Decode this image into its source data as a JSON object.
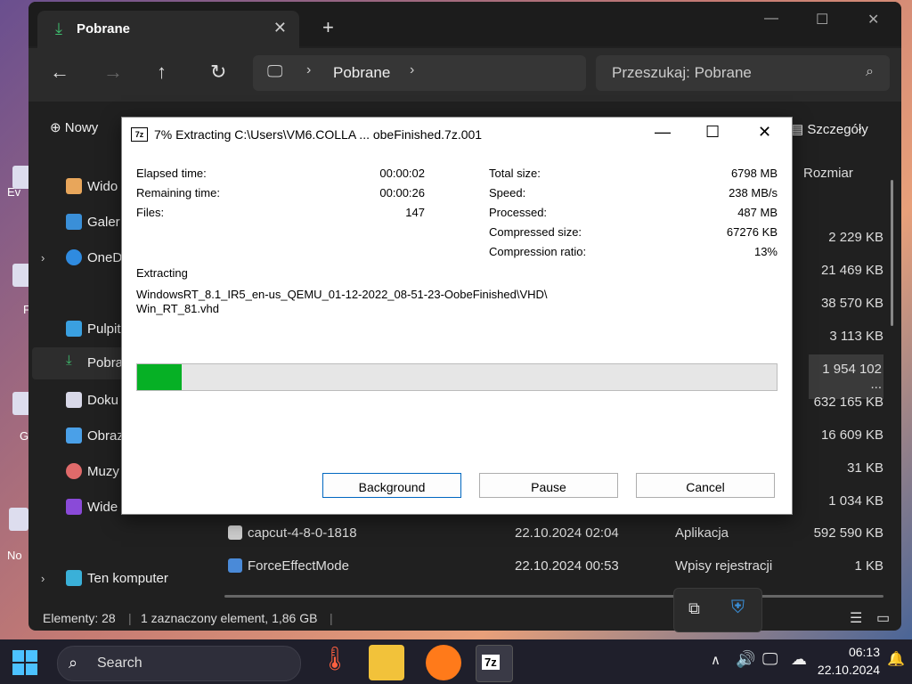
{
  "desktop": {
    "labels": [
      "Ev",
      "F",
      "G",
      "No"
    ]
  },
  "explorer": {
    "tab_title": "Pobrane",
    "address": {
      "location": "Pobrane"
    },
    "search_placeholder": "Przeszukaj: Pobrane",
    "new_button": "Nowy",
    "details_button": "Szczegóły",
    "column_size_header": "Rozmiar",
    "sidebar": [
      "Wido",
      "Galer",
      "OneD",
      "Pulpit",
      "Pobra",
      "Doku",
      "Obraz",
      "Muzy",
      "Wide",
      "Ten komputer"
    ],
    "sizes": [
      "2 229 KB",
      "21 469 KB",
      "38 570 KB",
      "3 113 KB",
      "1 954 102 ...",
      "632 165 KB",
      "16 609 KB",
      "31 KB",
      "1 034 KB"
    ],
    "files": [
      {
        "name": "capcut-4-8-0-1818",
        "date": "22.10.2024 02:04",
        "type": "Aplikacja",
        "size": "592 590 KB"
      },
      {
        "name": "ForceEffectMode",
        "date": "22.10.2024 00:53",
        "type": "Wpisy rejestracji",
        "size": "1 KB"
      }
    ],
    "status": {
      "count": "Elementy: 28",
      "selected": "1 zaznaczony element, 1,86 GB"
    }
  },
  "dialog": {
    "title": "7% Extracting C:\\Users\\VM6.COLLA ... obeFinished.7z.001",
    "logo": "7z",
    "stats_left": [
      {
        "label": "Elapsed time:",
        "value": "00:00:02"
      },
      {
        "label": "Remaining time:",
        "value": "00:00:26"
      },
      {
        "label": "Files:",
        "value": "147"
      }
    ],
    "stats_right": [
      {
        "label": "Total size:",
        "value": "6798 MB"
      },
      {
        "label": "Speed:",
        "value": "238 MB/s"
      },
      {
        "label": "Processed:",
        "value": "487 MB"
      },
      {
        "label": "Compressed size:",
        "value": "67276 KB"
      },
      {
        "label": "Compression ratio:",
        "value": "13%"
      }
    ],
    "extracting_label": "Extracting",
    "path_line1": "WindowsRT_8.1_IR5_en-us_QEMU_01-12-2022_08-51-23-OobeFinished\\VHD\\",
    "path_line2": "Win_RT_81.vhd",
    "progress_percent": 7,
    "buttons": {
      "background": "Background",
      "pause": "Pause",
      "cancel": "Cancel"
    }
  },
  "taskbar": {
    "search_label": "Search",
    "time": "06:13",
    "date": "22.10.2024"
  },
  "colors": {
    "progress_fill": "#06b025",
    "accent": "#0067c0",
    "explorer_bg": "#202020"
  }
}
